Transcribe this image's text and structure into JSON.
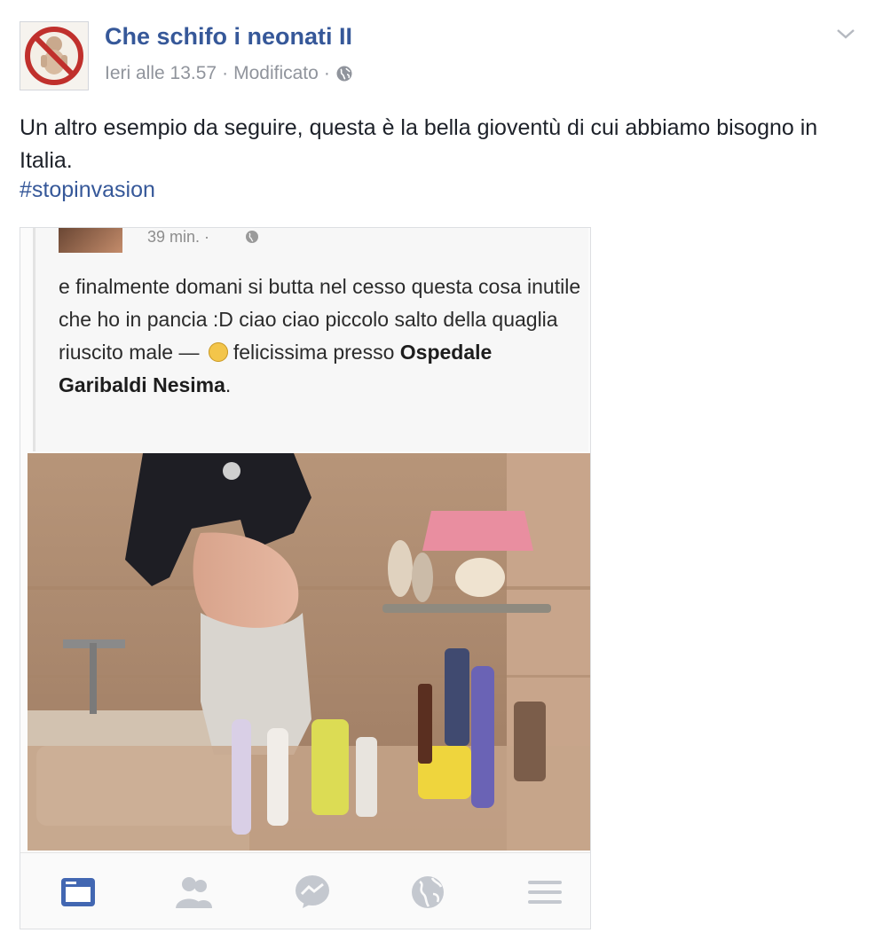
{
  "post": {
    "page_name": "Che schifo i neonati II",
    "timestamp": "Ieri alle 13.57",
    "edited": "Modificato",
    "separator": "·",
    "text": "Un altro esempio da seguire, questa è la bella gioventù di cui abbiamo bisogno in Italia.",
    "hashtag": "#stopinvasion"
  },
  "screenshot": {
    "time": "39 min. ·",
    "text": "e finalmente domani si butta nel cesso questa cosa inutile che ho in pancia :D ciao ciao piccolo salto della quaglia riuscito male —",
    "feeling": "felicissima presso",
    "place": "Ospedale Garibaldi Nesima",
    "place_end": ".",
    "tabs": [
      "news-feed",
      "friends",
      "messenger",
      "notifications",
      "menu"
    ]
  },
  "colors": {
    "link": "#365899",
    "meta": "#90949c",
    "tab_active": "#4267b2",
    "tab_inactive": "#c4c8cf"
  }
}
